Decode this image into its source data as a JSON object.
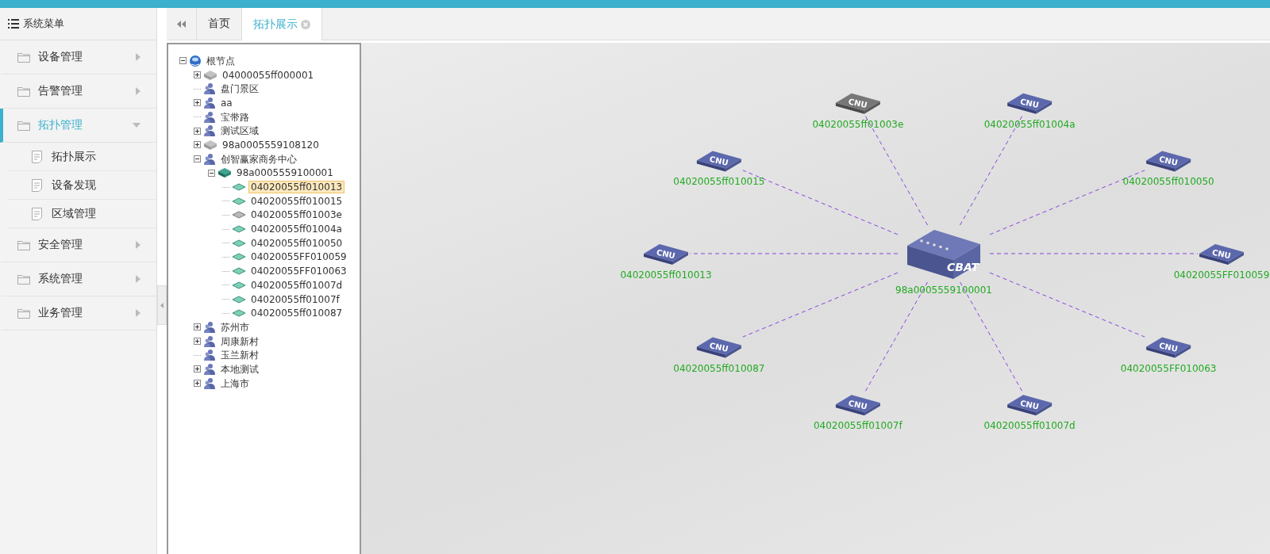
{
  "sidebar": {
    "title": "系统菜单",
    "items": [
      {
        "label": "设备管理",
        "expanded": false,
        "selected": false
      },
      {
        "label": "告警管理",
        "expanded": false,
        "selected": false
      },
      {
        "label": "拓扑管理",
        "expanded": true,
        "selected": true,
        "children": [
          {
            "label": "拓扑展示"
          },
          {
            "label": "设备发现"
          },
          {
            "label": "区域管理"
          }
        ]
      },
      {
        "label": "安全管理",
        "expanded": false,
        "selected": false
      },
      {
        "label": "系统管理",
        "expanded": false,
        "selected": false
      },
      {
        "label": "业务管理",
        "expanded": false,
        "selected": false
      }
    ]
  },
  "tabs": [
    {
      "label": "首页",
      "selected": false,
      "closable": false
    },
    {
      "label": "拓扑展示",
      "selected": true,
      "closable": true
    }
  ],
  "tree": [
    {
      "label": "根节点",
      "kind": "root",
      "expanded": true,
      "selected": false,
      "children": [
        {
          "label": "04000055ff000001",
          "kind": "cbat",
          "online": false,
          "expanded": false,
          "selected": false
        },
        {
          "label": "盘门景区",
          "kind": "area",
          "selected": false
        },
        {
          "label": "aa",
          "kind": "area",
          "expanded": false,
          "selected": false
        },
        {
          "label": "宝带路",
          "kind": "area",
          "selected": false
        },
        {
          "label": "测试区域",
          "kind": "area",
          "expanded": false,
          "selected": false
        },
        {
          "label": "98a0005559108120",
          "kind": "cbat",
          "online": false,
          "expanded": false,
          "selected": false
        },
        {
          "label": "创智赢家商务中心",
          "kind": "area",
          "expanded": true,
          "selected": false,
          "children": [
            {
              "label": "98a0005559100001",
              "kind": "cbat",
              "online": true,
              "expanded": true,
              "selected": false,
              "children": [
                {
                  "label": "04020055ff010013",
                  "kind": "cnu",
                  "online": true,
                  "selected": true
                },
                {
                  "label": "04020055ff010015",
                  "kind": "cnu",
                  "online": true,
                  "selected": false
                },
                {
                  "label": "04020055ff01003e",
                  "kind": "cnu",
                  "online": false,
                  "selected": false
                },
                {
                  "label": "04020055ff01004a",
                  "kind": "cnu",
                  "online": true,
                  "selected": false
                },
                {
                  "label": "04020055ff010050",
                  "kind": "cnu",
                  "online": true,
                  "selected": false
                },
                {
                  "label": "04020055FF010059",
                  "kind": "cnu",
                  "online": true,
                  "selected": false
                },
                {
                  "label": "04020055FF010063",
                  "kind": "cnu",
                  "online": true,
                  "selected": false
                },
                {
                  "label": "04020055ff01007d",
                  "kind": "cnu",
                  "online": true,
                  "selected": false
                },
                {
                  "label": "04020055ff01007f",
                  "kind": "cnu",
                  "online": true,
                  "selected": false
                },
                {
                  "label": "04020055ff010087",
                  "kind": "cnu",
                  "online": true,
                  "selected": false
                }
              ]
            }
          ]
        },
        {
          "label": "苏州市",
          "kind": "area",
          "expanded": false,
          "selected": false
        },
        {
          "label": "周康新村",
          "kind": "area",
          "expanded": false,
          "selected": false
        },
        {
          "label": "玉兰新村",
          "kind": "area",
          "selected": false
        },
        {
          "label": "本地测试",
          "kind": "area",
          "expanded": false,
          "selected": false
        },
        {
          "label": "上海市",
          "kind": "area",
          "expanded": false,
          "selected": false
        }
      ]
    }
  ],
  "topology": {
    "center": {
      "type": "CBAT",
      "label": "98a0005559100001"
    },
    "nodes": [
      {
        "type": "CNU",
        "label": "04020055ff01003e",
        "online": false
      },
      {
        "type": "CNU",
        "label": "04020055ff01004a",
        "online": true
      },
      {
        "type": "CNU",
        "label": "04020055ff010015",
        "online": true
      },
      {
        "type": "CNU",
        "label": "04020055ff010050",
        "online": true
      },
      {
        "type": "CNU",
        "label": "04020055ff010013",
        "online": true
      },
      {
        "type": "CNU",
        "label": "04020055FF010059",
        "online": true
      },
      {
        "type": "CNU",
        "label": "04020055ff010087",
        "online": true
      },
      {
        "type": "CNU",
        "label": "04020055FF010063",
        "online": true
      },
      {
        "type": "CNU",
        "label": "04020055ff01007f",
        "online": true
      },
      {
        "type": "CNU",
        "label": "04020055ff01007d",
        "online": true
      }
    ]
  }
}
